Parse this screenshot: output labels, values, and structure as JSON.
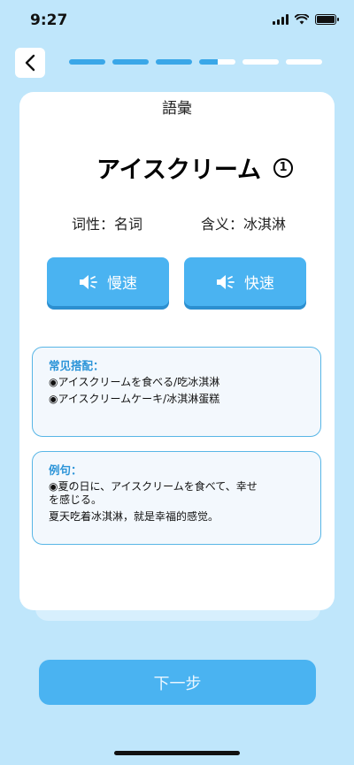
{
  "status": {
    "time": "9:27"
  },
  "progress": {
    "total_segments": 6,
    "current_step": 4,
    "current_fraction": 0.5
  },
  "card": {
    "title": "語彙",
    "word": "アイスクリーム",
    "word_index": "1",
    "part_of_speech": "词性：名词",
    "meaning": "含义：冰淇淋",
    "slow_label": "慢速",
    "fast_label": "快速"
  },
  "collocations": {
    "heading": "常见搭配：",
    "items": [
      "◉アイスクリームを食べる/吃冰淇淋",
      "◉アイスクリームケーキ/冰淇淋蛋糕"
    ]
  },
  "examples": {
    "heading": "例句：",
    "sentence": "◉夏の日に、アイスクリームを食べて、幸せ\nを感じる。",
    "translation": "夏天吃着冰淇淋，就是幸福的感觉。"
  },
  "next_label": "下一步",
  "colors": {
    "background": "#bfe6fb",
    "accent": "#4ab3f1",
    "accent_dark": "#2c8fd0",
    "heading": "#2b94d8"
  }
}
